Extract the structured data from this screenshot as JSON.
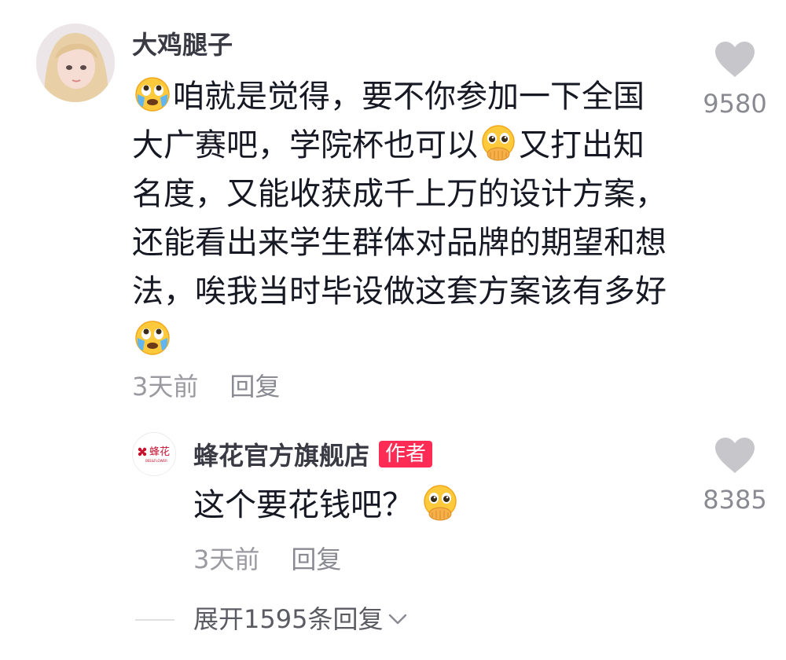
{
  "comment": {
    "username": "大鸡腿子",
    "text_segments": [
      {
        "type": "emoji",
        "icon": "crying-face-emoji"
      },
      {
        "type": "text",
        "value": "咱就是觉得，要不你参加一下全国大广赛吧，学院杯也可以"
      },
      {
        "type": "emoji",
        "icon": "pleading-hand-over-mouth-emoji"
      },
      {
        "type": "text",
        "value": "又打出知名度，又能收获成千上万的设计方案，还能看出来学生群体对品牌的期望和想法，唉我当时毕设做这套方案该有多好"
      },
      {
        "type": "emoji",
        "icon": "crying-face-emoji"
      }
    ],
    "time": "3天前",
    "reply_label": "回复",
    "like_count": "9580",
    "like_icon": "heart-icon"
  },
  "reply": {
    "username": "蜂花官方旗舰店",
    "badge": "作者",
    "avatar_logo_text": "蜂花",
    "avatar_logo_subtext": "BEE&FLOWER",
    "text": "这个要花钱吧？",
    "emoji": "pleading-hand-over-mouth-emoji",
    "time": "3天前",
    "reply_label": "回复",
    "like_count": "8385",
    "like_icon": "heart-icon"
  },
  "expand": {
    "label": "展开1595条回复",
    "icon": "chevron-down-icon"
  },
  "colors": {
    "badge_bg": "#fe2c55",
    "heart": "#c6c6cb",
    "meta_text": "#9a9aa0"
  }
}
